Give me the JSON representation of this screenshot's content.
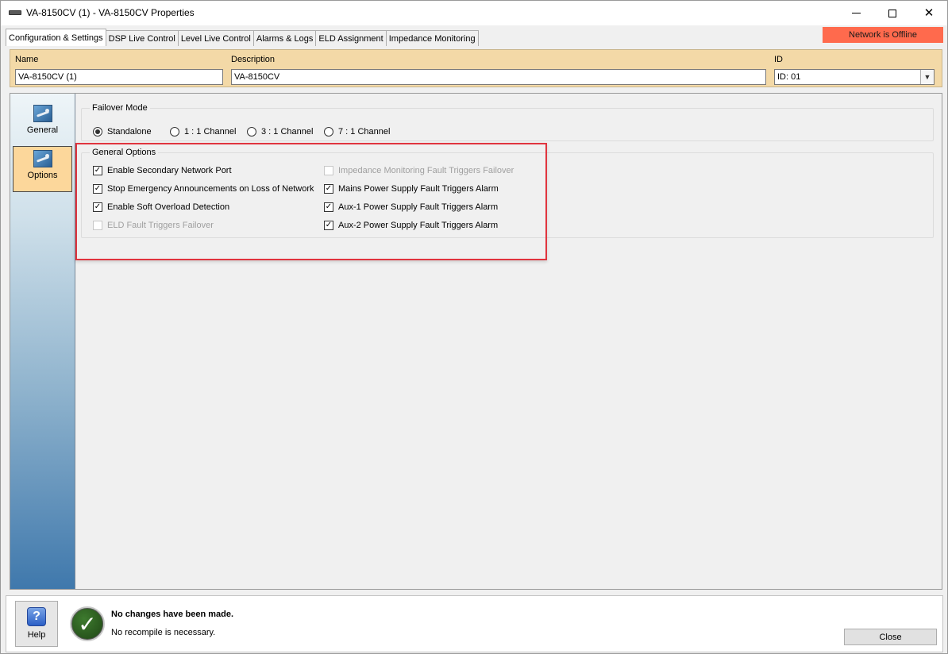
{
  "window": {
    "title": "VA-8150CV (1) - VA-8150CV Properties"
  },
  "tabs": [
    {
      "label": "Configuration & Settings",
      "active": true
    },
    {
      "label": "DSP Live Control",
      "active": false
    },
    {
      "label": "Level Live Control",
      "active": false
    },
    {
      "label": "Alarms & Logs",
      "active": false
    },
    {
      "label": "ELD Assignment",
      "active": false
    },
    {
      "label": "Impedance Monitoring",
      "active": false
    }
  ],
  "status_banner": "Network is Offline",
  "header": {
    "name_label": "Name",
    "name_value": "VA-8150CV (1)",
    "description_label": "Description",
    "description_value": "VA-8150CV",
    "id_label": "ID",
    "id_value": "ID: 01"
  },
  "sidebar": {
    "items": [
      {
        "label": "General",
        "icon": "settings-wrench-icon",
        "active": false
      },
      {
        "label": "Options",
        "icon": "settings-wrench-icon",
        "active": true
      }
    ]
  },
  "failover": {
    "title": "Failover Mode",
    "options": [
      {
        "label": "Standalone",
        "selected": true
      },
      {
        "label": "1 : 1 Channel",
        "selected": false
      },
      {
        "label": "3 : 1 Channel",
        "selected": false
      },
      {
        "label": "7 : 1 Channel",
        "selected": false
      }
    ]
  },
  "general_options": {
    "title": "General Options",
    "left": [
      {
        "label": "Enable Secondary Network Port",
        "checked": true,
        "enabled": true
      },
      {
        "label": "Stop Emergency Announcements on Loss of Network",
        "checked": true,
        "enabled": true
      },
      {
        "label": "Enable Soft Overload Detection",
        "checked": true,
        "enabled": true
      },
      {
        "label": "ELD Fault Triggers Failover",
        "checked": false,
        "enabled": false
      }
    ],
    "right": [
      {
        "label": "Impedance Monitoring Fault Triggers Failover",
        "checked": false,
        "enabled": false
      },
      {
        "label": "Mains Power Supply Fault Triggers Alarm",
        "checked": true,
        "enabled": true
      },
      {
        "label": "Aux-1 Power Supply Fault Triggers Alarm",
        "checked": true,
        "enabled": true
      },
      {
        "label": "Aux-2 Power Supply Fault Triggers Alarm",
        "checked": true,
        "enabled": true
      }
    ]
  },
  "footer": {
    "help_label": "Help",
    "message_title": "No changes have been made.",
    "message_sub": "No recompile is necessary.",
    "close_label": "Close"
  },
  "colors": {
    "status_banner": "#ff6a4d",
    "header_panel": "#f3d9a7",
    "active_sidebar": "#fcd79b",
    "highlight_box": "#e0343e"
  }
}
